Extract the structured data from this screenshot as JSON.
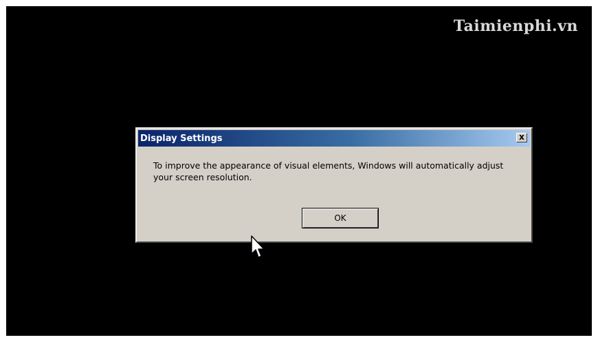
{
  "watermark": "Taimienphi.vn",
  "dialog": {
    "title": "Display Settings",
    "close_label": "x",
    "message": "To improve the appearance of visual elements, Windows will automatically adjust your screen resolution.",
    "ok_label": "OK"
  },
  "colors": {
    "titlebar_start": "#0a246a",
    "titlebar_end": "#a6caf0",
    "dialog_face": "#d4d0c8",
    "desktop": "#000000"
  },
  "icons": {
    "cursor": "mouse-pointer-icon",
    "close": "close-icon"
  }
}
